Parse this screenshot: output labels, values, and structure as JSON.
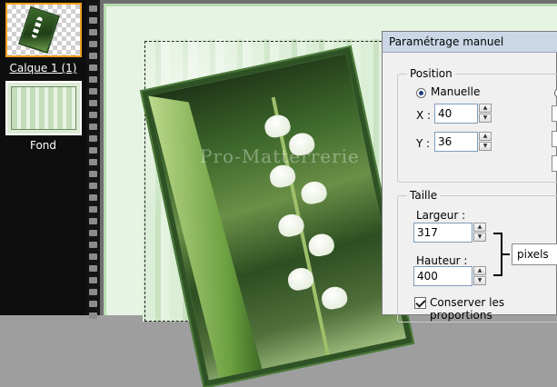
{
  "layers": [
    {
      "name": "Calque 1 (1)",
      "selected": true
    },
    {
      "name": "Fond",
      "selected": false
    }
  ],
  "canvas": {
    "watermark": "Pro-Matterrerie"
  },
  "dialog": {
    "title": "Paramétrage manuel",
    "position": {
      "legend": "Position",
      "mode_label": "Manuelle",
      "x_label": "X :",
      "x_value": "40",
      "y_label": "Y :",
      "y_value": "36"
    },
    "size": {
      "legend": "Taille",
      "width_label": "Largeur :",
      "width_value": "317",
      "height_label": "Hauteur :",
      "height_value": "400",
      "unit_selected": "pixels",
      "keep_ratio_label": "Conserver les proportions",
      "keep_ratio_checked": true
    }
  },
  "colors": {
    "selection_border": "#f0a020",
    "dialog_title_bg": "#cbd7e7"
  }
}
